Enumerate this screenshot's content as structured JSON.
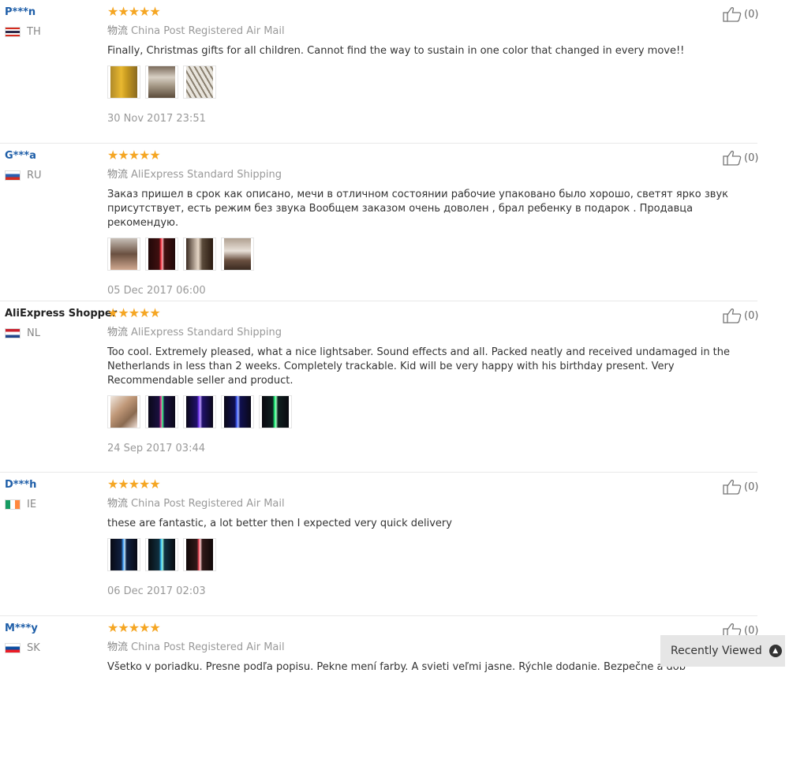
{
  "reviews": [
    {
      "user": "P***n",
      "country": "TH",
      "stars": "★★★★★",
      "ship_cn": "物流",
      "shipping": "China Post Registered Air Mail",
      "text": "Finally, Christmas gifts for all children. Cannot find the way to sustain in one color that changed in every move!!",
      "date": "30 Nov 2017 23:51",
      "likes": "(0)"
    },
    {
      "user": "G***a",
      "country": "RU",
      "stars": "★★★★★",
      "ship_cn": "物流",
      "shipping": "AliExpress Standard Shipping",
      "text": "Заказ пришел в срок как описано, мечи в отличном состоянии рабочие упаковано было хорошо, светят ярко звук присутствует, есть режим без звука Вообщем заказом очень доволен , брал ребенку в подарок . Продавца рекомендую.",
      "date": "05 Dec 2017 06:00",
      "likes": "(0)"
    },
    {
      "user": "AliExpress Shopper",
      "country": "NL",
      "stars": "★★★★★",
      "ship_cn": "物流",
      "shipping": "AliExpress Standard Shipping",
      "text": "Too cool. Extremely pleased, what a nice lightsaber. Sound effects and all. Packed neatly and received undamaged in the Netherlands in less than 2 weeks. Completely trackable. Kid will be very happy with his birthday present. Very Recommendable seller and product.",
      "date": "24 Sep 2017 03:44",
      "likes": "(0)"
    },
    {
      "user": "D***h",
      "country": "IE",
      "stars": "★★★★★",
      "ship_cn": "物流",
      "shipping": "China Post Registered Air Mail",
      "text": "these are fantastic, a lot better then I expected very quick delivery",
      "date": "06 Dec 2017 02:03",
      "likes": "(0)"
    },
    {
      "user": "M***y",
      "country": "SK",
      "stars": "★★★★★",
      "ship_cn": "物流",
      "shipping": "China Post Registered Air Mail",
      "text": "Všetko v poriadku. Presne podľa popisu. Pekne mení farby. A svieti veľmi jasne. Rýchle dodanie. Bezpečne a dob",
      "likes": "(0)"
    }
  ],
  "recently_viewed": "Recently Viewed",
  "icons": {
    "like": "thumbs-up-icon",
    "up": "chevron-up-icon"
  },
  "colors": {
    "star": "#f5a623",
    "username": "#1e5ea8"
  }
}
